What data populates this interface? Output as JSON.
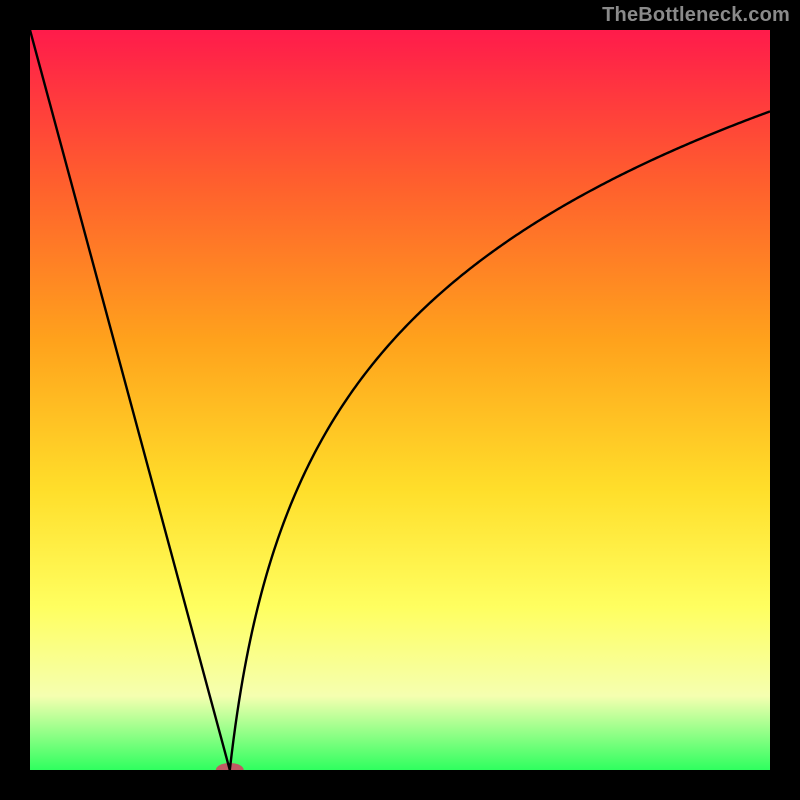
{
  "watermark": "TheBottleneck.com",
  "chart_data": {
    "type": "line",
    "title": "",
    "xlabel": "",
    "ylabel": "",
    "xlim": [
      0,
      100
    ],
    "ylim": [
      0,
      100
    ],
    "background_gradient": [
      "#ff1b4b",
      "#ff5d2e",
      "#ffa21c",
      "#ffde2a",
      "#ffff60",
      "#f5ffb0",
      "#2fff5f"
    ],
    "background_gradient_positions": [
      0,
      20,
      42,
      62,
      78,
      90,
      100
    ],
    "curve_sample": {
      "x": [
        0,
        5,
        10,
        15,
        20,
        23,
        25,
        26,
        27,
        28,
        30,
        33,
        36,
        40,
        45,
        50,
        55,
        60,
        65,
        70,
        75,
        80,
        85,
        90,
        95,
        100
      ],
      "y": [
        100,
        81,
        62,
        43,
        24,
        12,
        4,
        1,
        0,
        2,
        9,
        20,
        29,
        40,
        50,
        58,
        64,
        69,
        73,
        77,
        80,
        82.5,
        84.5,
        86.3,
        87.8,
        89
      ]
    },
    "marker": {
      "x": 27,
      "y": 0,
      "color": "#c05a63",
      "rx": 14,
      "ry": 7
    },
    "colors": {
      "curve": "#000000",
      "frame": "#000000"
    }
  }
}
